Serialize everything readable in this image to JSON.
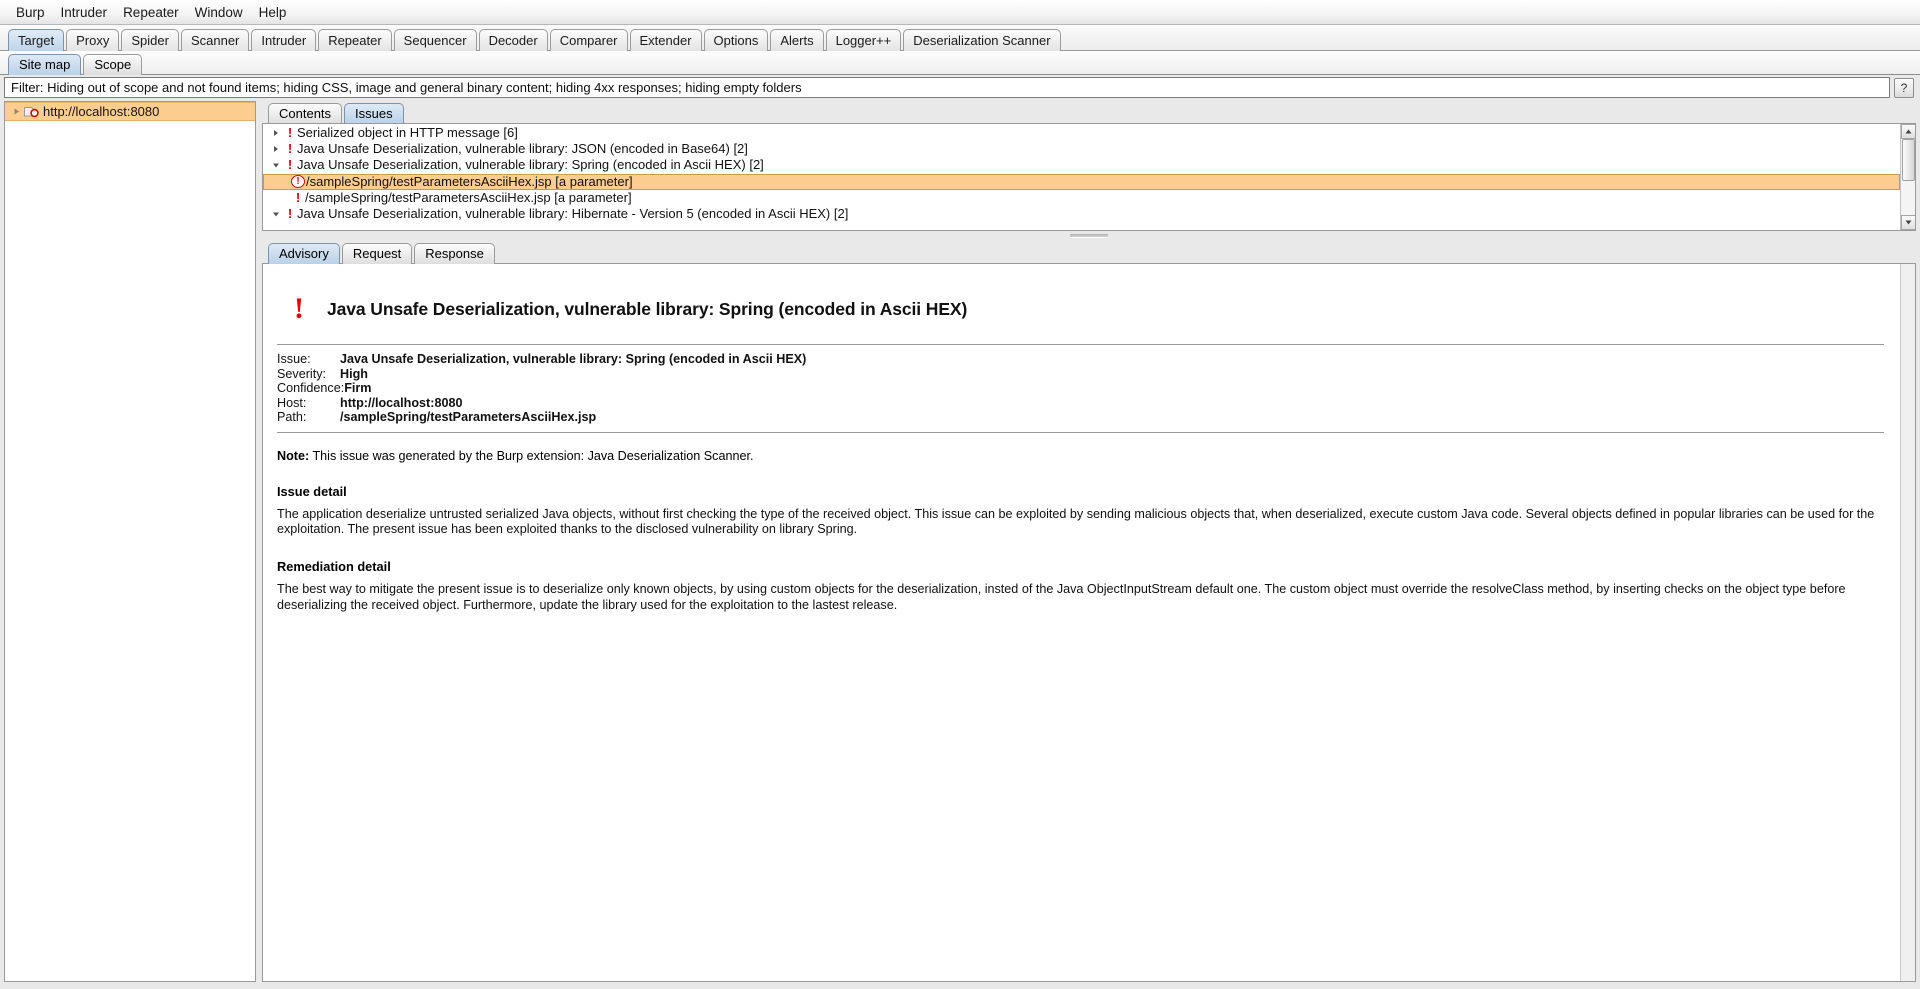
{
  "menu": {
    "items": [
      "Burp",
      "Intruder",
      "Repeater",
      "Window",
      "Help"
    ]
  },
  "main_tabs": {
    "active": "Target",
    "items": [
      "Target",
      "Proxy",
      "Spider",
      "Scanner",
      "Intruder",
      "Repeater",
      "Sequencer",
      "Decoder",
      "Comparer",
      "Extender",
      "Options",
      "Alerts",
      "Logger++",
      "Deserialization Scanner"
    ]
  },
  "sub_tabs": {
    "active": "Site map",
    "items": [
      "Site map",
      "Scope"
    ]
  },
  "filter": {
    "text": "Filter: Hiding out of scope and not found items;  hiding CSS, image and general binary content;  hiding 4xx responses;  hiding empty folders",
    "help_label": "?"
  },
  "sitemap": {
    "host": "http://localhost:8080",
    "twisty_icon": "chevron-right-icon",
    "host_icon": "target-host-icon"
  },
  "issues": {
    "tabs": {
      "active": "Issues",
      "items": [
        "Contents",
        "Issues"
      ]
    },
    "rows": [
      {
        "indent": 1,
        "twisty": "collapsed",
        "marker": "bang",
        "label": "Serialized object in HTTP message [6]",
        "selected": false
      },
      {
        "indent": 1,
        "twisty": "collapsed",
        "marker": "bang",
        "label": "Java Unsafe Deserialization, vulnerable library: JSON (encoded in Base64) [2]",
        "selected": false
      },
      {
        "indent": 1,
        "twisty": "expanded",
        "marker": "bang",
        "label": "Java Unsafe Deserialization, vulnerable library: Spring (encoded in Ascii HEX) [2]",
        "selected": false
      },
      {
        "indent": 2,
        "twisty": "none",
        "marker": "bang-circle",
        "label": "/sampleSpring/testParametersAsciiHex.jsp [a parameter]",
        "selected": true
      },
      {
        "indent": 2,
        "twisty": "none",
        "marker": "bang",
        "label": "/sampleSpring/testParametersAsciiHex.jsp [a parameter]",
        "selected": false
      },
      {
        "indent": 1,
        "twisty": "expanded",
        "marker": "bang",
        "label": "Java Unsafe Deserialization, vulnerable library: Hibernate - Version 5 (encoded in Ascii HEX) [2]",
        "selected": false
      }
    ]
  },
  "advisory": {
    "tabs": {
      "active": "Advisory",
      "items": [
        "Advisory",
        "Request",
        "Response"
      ]
    },
    "title": "Java Unsafe Deserialization, vulnerable library: Spring (encoded in Ascii HEX)",
    "details": [
      {
        "key": "Issue:",
        "value": "Java Unsafe Deserialization, vulnerable library: Spring (encoded in Ascii HEX)"
      },
      {
        "key": "Severity:",
        "value": "High"
      },
      {
        "key": "Confidence:",
        "value": "Firm"
      },
      {
        "key": "Host:",
        "value": "http://localhost:8080"
      },
      {
        "key": "Path:",
        "value": "/sampleSpring/testParametersAsciiHex.jsp"
      }
    ],
    "note_label": "Note:",
    "note_text": " This issue was generated by the Burp extension: Java Deserialization Scanner.",
    "issue_detail_heading": "Issue detail",
    "issue_detail_text": "The application deserialize untrusted serialized Java objects, without first checking the type of the received object. This issue can be exploited by sending malicious objects that, when deserialized, execute custom Java code. Several objects defined in popular libraries can be used for the exploitation. The present issue has been exploited thanks to the disclosed vulnerability on library Spring.",
    "remediation_heading": "Remediation detail",
    "remediation_text": "The best way to mitigate the present issue is to deserialize only known objects, by using custom objects for the deserialization, insted of the Java ObjectInputStream default one. The custom object must override the resolveClass method, by inserting checks on the object type before deserializing the received object. Furthermore, update the library used for the exploitation to the lastest release.",
    "severity_color": "#ee0000"
  }
}
